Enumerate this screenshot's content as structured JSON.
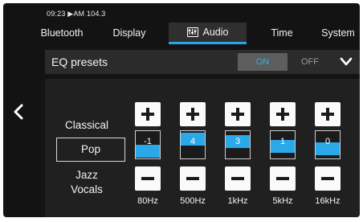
{
  "status_bar": {
    "text": "09:23 ▶AM 104.3"
  },
  "tabs": [
    {
      "label": "Bluetooth",
      "active": false
    },
    {
      "label": "Display",
      "active": false
    },
    {
      "label": "Audio",
      "active": true,
      "icon": "equalizer-icon"
    },
    {
      "label": "Time",
      "active": false
    },
    {
      "label": "System",
      "active": false
    }
  ],
  "eq": {
    "title": "EQ presets",
    "toggle_on": "ON",
    "toggle_off": "OFF",
    "toggle_state": "ON",
    "presets": [
      "Classical",
      "Pop",
      "Jazz",
      "Vocals"
    ],
    "selected_preset": "Pop",
    "bands": [
      {
        "freq": "80Hz",
        "value": "-1"
      },
      {
        "freq": "500Hz",
        "value": "4"
      },
      {
        "freq": "1kHz",
        "value": "3"
      },
      {
        "freq": "5kHz",
        "value": "1"
      },
      {
        "freq": "16kHz",
        "value": "0"
      }
    ]
  },
  "colors": {
    "accent": "#2aa8e8",
    "background": "#131313",
    "header": "#2b2b2b"
  }
}
